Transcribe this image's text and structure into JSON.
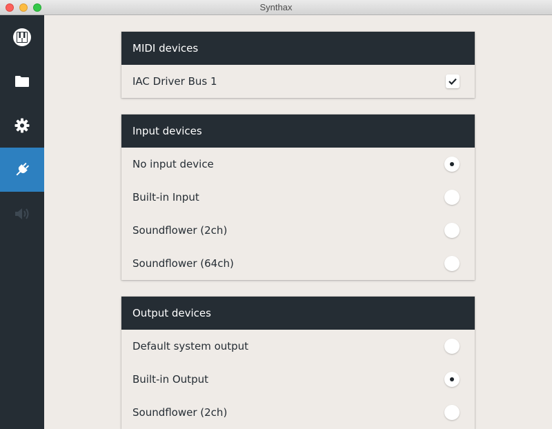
{
  "window": {
    "title": "Synthax"
  },
  "sidebar": {
    "items": [
      {
        "icon": "piano-icon",
        "active": false
      },
      {
        "icon": "folder-icon",
        "active": false
      },
      {
        "icon": "gear-icon",
        "active": false
      },
      {
        "icon": "plug-icon",
        "active": true
      },
      {
        "icon": "speaker-icon",
        "active": false,
        "disabled": true
      }
    ]
  },
  "midi": {
    "title": "MIDI devices",
    "devices": [
      {
        "label": "IAC Driver Bus 1",
        "checked": true
      }
    ]
  },
  "input": {
    "title": "Input devices",
    "devices": [
      {
        "label": "No input device",
        "selected": true
      },
      {
        "label": "Built-in Input",
        "selected": false
      },
      {
        "label": "Soundflower (2ch)",
        "selected": false
      },
      {
        "label": "Soundflower (64ch)",
        "selected": false
      }
    ]
  },
  "output": {
    "title": "Output devices",
    "devices": [
      {
        "label": "Default system output",
        "selected": false
      },
      {
        "label": "Built-in Output",
        "selected": true
      },
      {
        "label": "Soundflower (2ch)",
        "selected": false
      }
    ]
  },
  "colors": {
    "sidebar_bg": "#252d34",
    "active_accent": "#2d80c0",
    "content_bg": "#efebe7"
  }
}
